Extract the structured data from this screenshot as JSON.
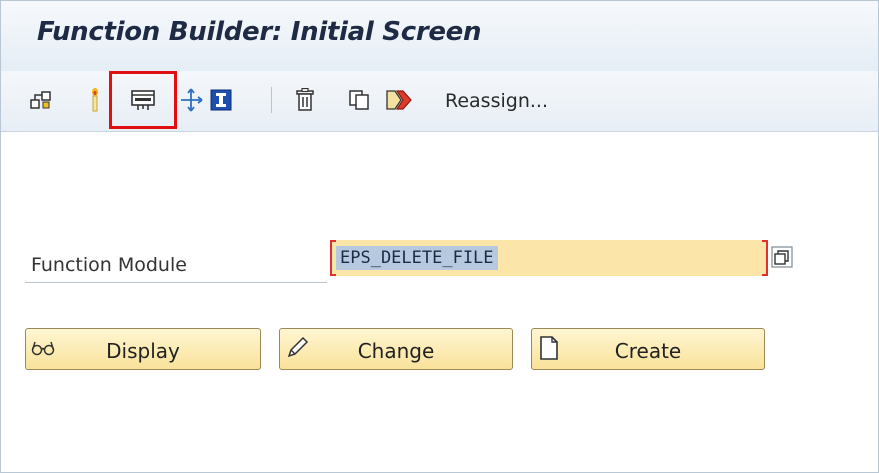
{
  "window": {
    "title": "Function Builder: Initial Screen"
  },
  "toolbar": {
    "icons": [
      "where-used-icon",
      "lamp-icon",
      "test-execute-icon",
      "other-object-icon",
      "info-icon",
      "delete-icon",
      "copy-icon",
      "rename-icon"
    ],
    "reassign_label": "Reassign..."
  },
  "form": {
    "function_module_label": "Function Module",
    "function_module_value": "EPS_DELETE_FILE"
  },
  "buttons": {
    "display_label": "Display",
    "change_label": "Change",
    "create_label": "Create"
  },
  "colors": {
    "title_text": "#1f2a44",
    "highlight": "#e01010",
    "input_bg": "#fbe5a8",
    "selection_bg": "#b7c9df",
    "button_bg": "#f9e29a"
  }
}
